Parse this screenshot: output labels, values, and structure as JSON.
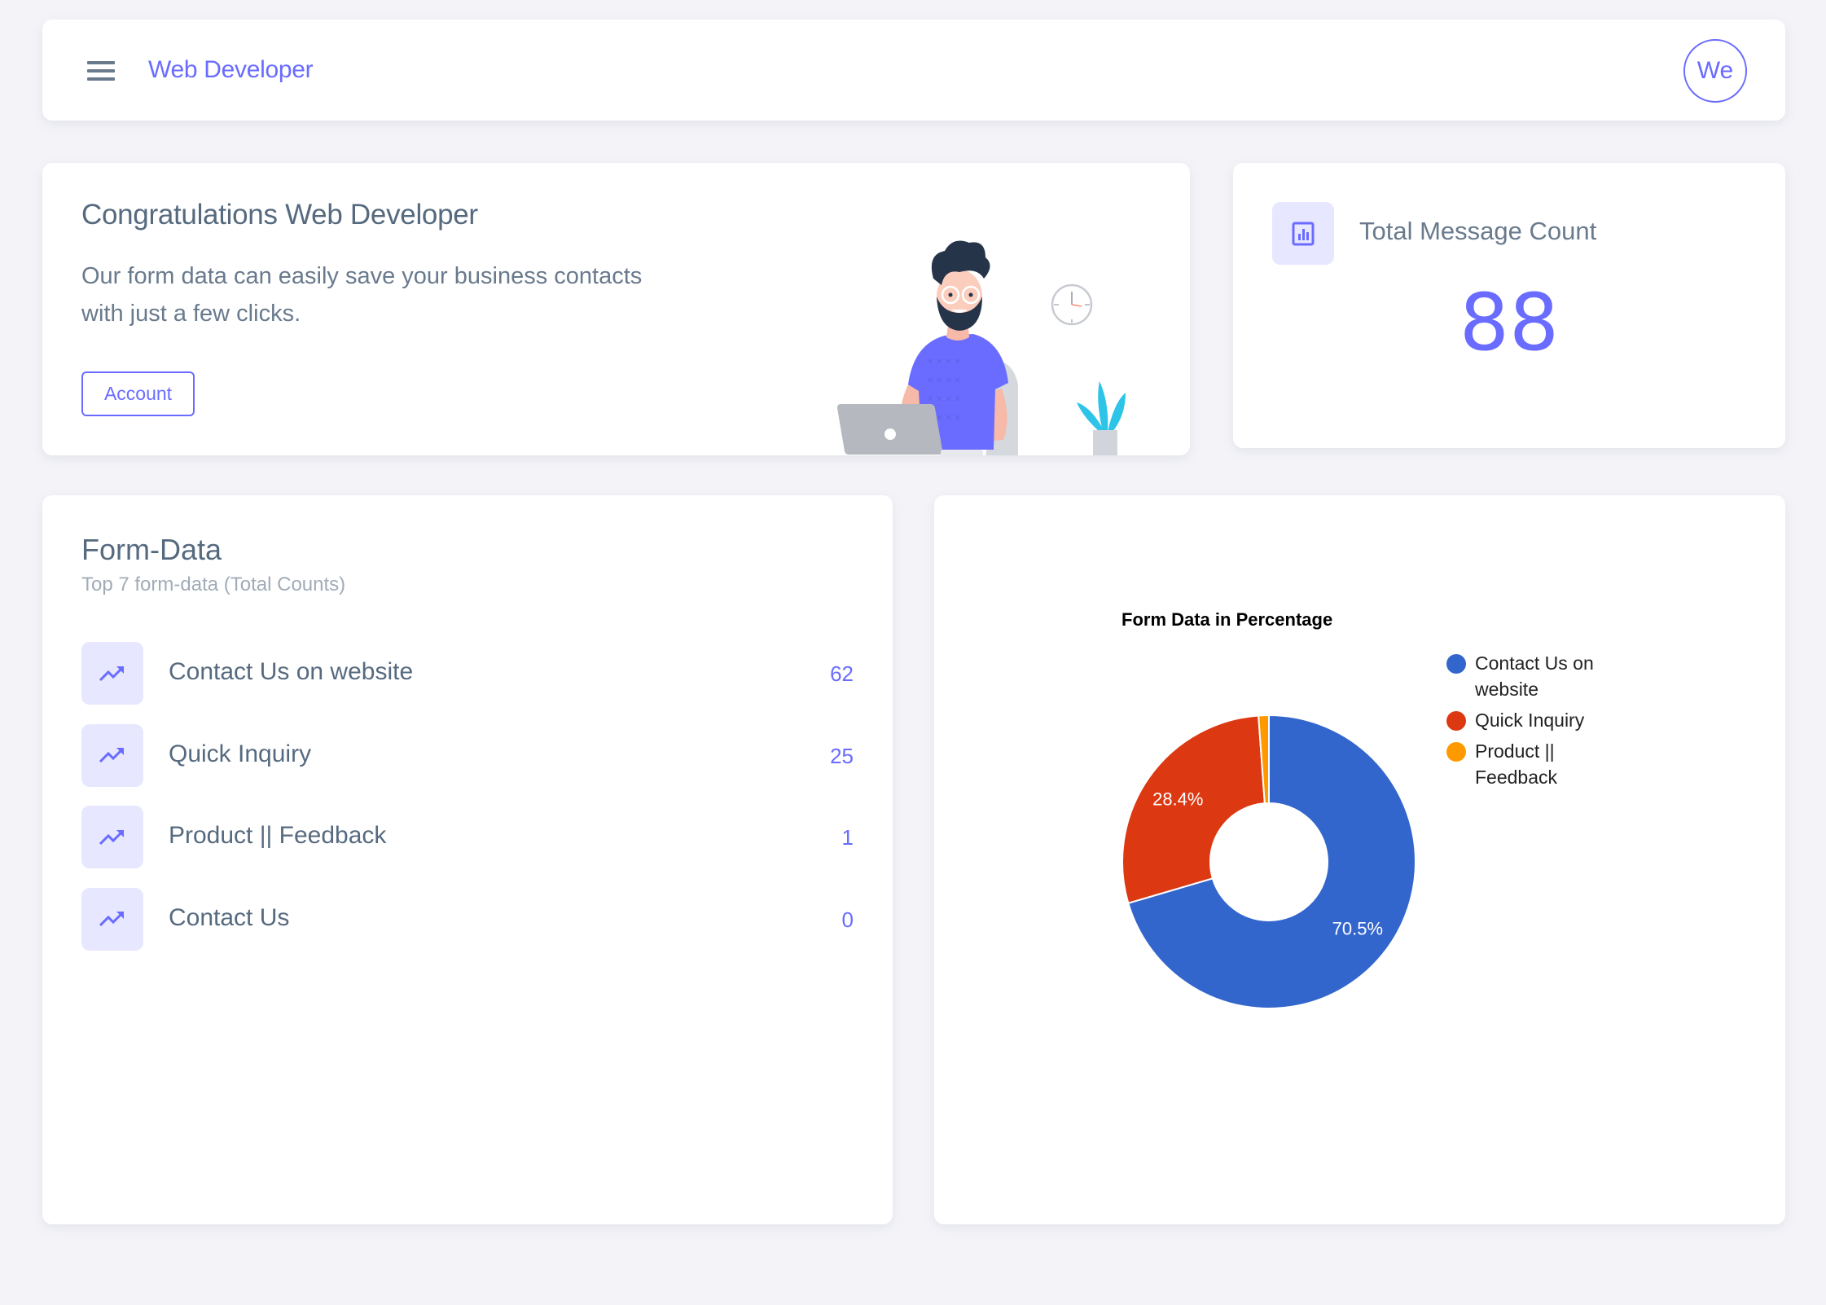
{
  "header": {
    "brand": "Web Developer",
    "avatar_initials": "We"
  },
  "congrats": {
    "title": "Congratulations Web Developer",
    "text": "Our form data can easily save your business contacts with just a few clicks.",
    "button_label": "Account"
  },
  "total": {
    "label": "Total Message Count",
    "value": "88",
    "icon": "bar-chart-icon"
  },
  "formdata": {
    "title": "Form-Data",
    "subtitle": "Top 7 form-data (Total Counts)",
    "items": [
      {
        "label": "Contact Us on website",
        "value": "62",
        "icon": "trending-up-icon"
      },
      {
        "label": "Quick Inquiry",
        "value": "25",
        "icon": "trending-up-icon"
      },
      {
        "label": "Product || Feedback",
        "value": "1",
        "icon": "trending-up-icon"
      },
      {
        "label": "Contact Us",
        "value": "0",
        "icon": "trending-up-icon"
      }
    ]
  },
  "colors": {
    "accent": "#696cff",
    "accent_soft": "#e7e7ff",
    "background": "#f4f4f8"
  },
  "chart_data": {
    "type": "pie",
    "donut": true,
    "title": "Form Data in Percentage",
    "legend_position": "right",
    "categories": [
      "Contact Us on website",
      "Quick Inquiry",
      "Product || Feedback"
    ],
    "values": [
      62,
      25,
      1
    ],
    "percent_labels": [
      "70.5%",
      "28.4%",
      ""
    ],
    "colors": [
      "#3366cc",
      "#dc3912",
      "#ff9900"
    ]
  }
}
